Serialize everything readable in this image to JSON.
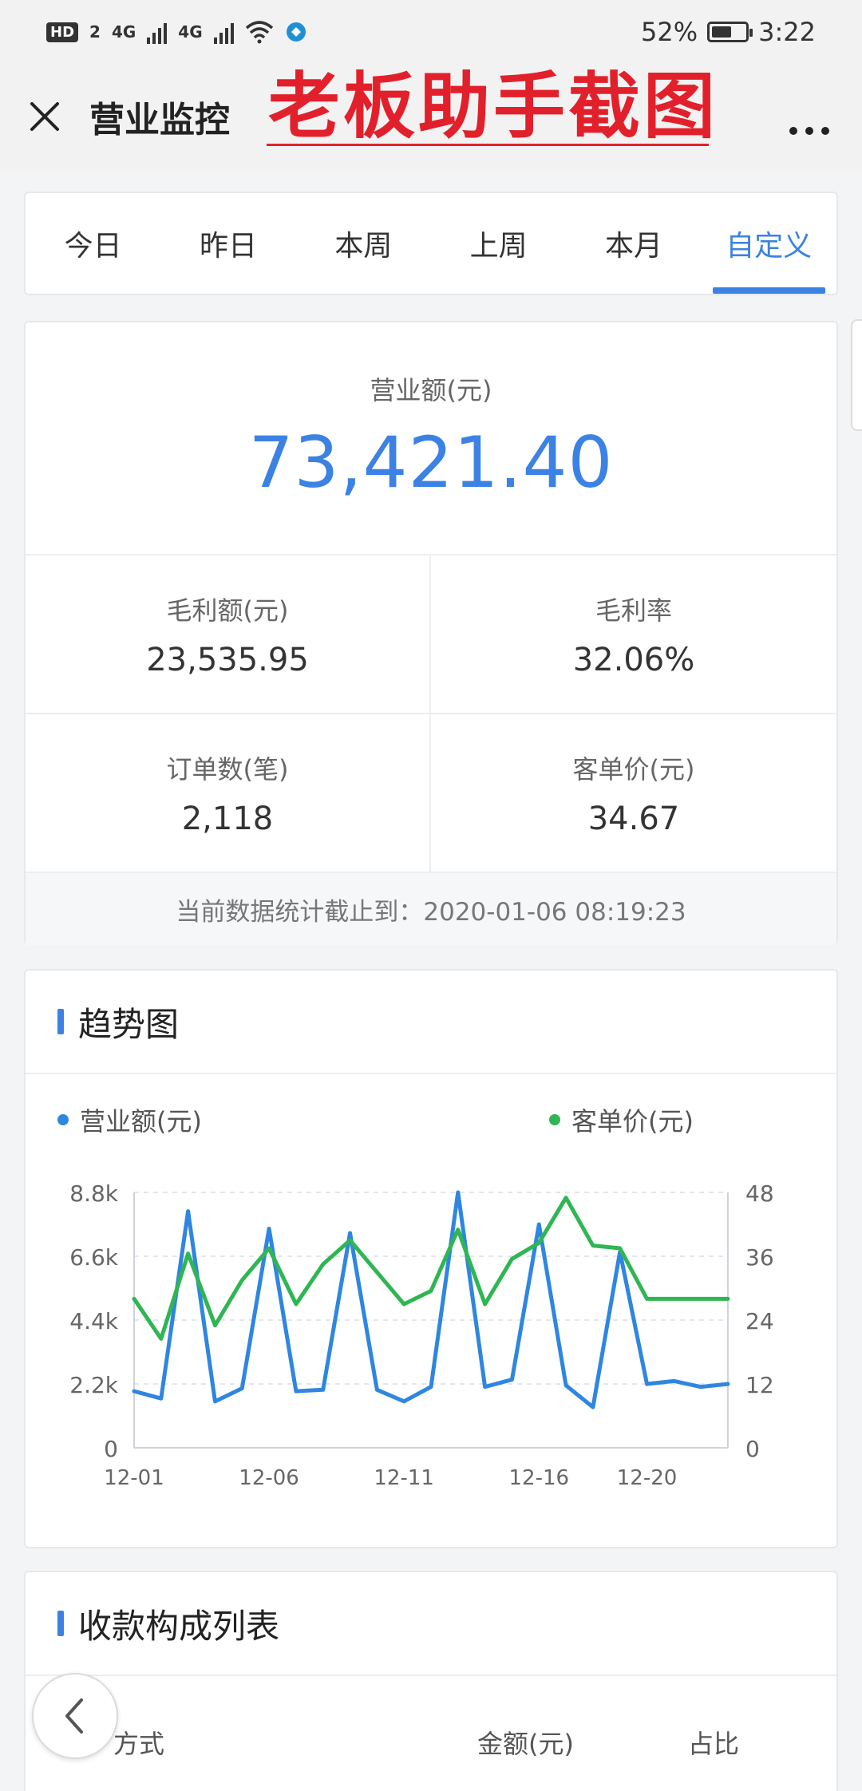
{
  "status_bar": {
    "hd": "HD",
    "hd_sub": "2",
    "net1": "4G",
    "net2": "4G",
    "battery": "52%",
    "battery_level": 0.52,
    "time": "3:22"
  },
  "titlebar": {
    "title": "营业监控",
    "watermark": "老板助手截图"
  },
  "tabs": [
    {
      "label": "今日",
      "active": false
    },
    {
      "label": "昨日",
      "active": false
    },
    {
      "label": "本周",
      "active": false
    },
    {
      "label": "上周",
      "active": false
    },
    {
      "label": "本月",
      "active": false
    },
    {
      "label": "自定义",
      "active": true
    }
  ],
  "summary": {
    "revenue_label": "营业额(元)",
    "revenue_value": "73,421.40",
    "metrics": [
      {
        "label": "毛利额(元)",
        "value": "23,535.95"
      },
      {
        "label": "毛利率",
        "value": "32.06%"
      },
      {
        "label": "订单数(笔)",
        "value": "2,118"
      },
      {
        "label": "客单价(元)",
        "value": "34.67"
      }
    ],
    "footnote": "当前数据统计截止到：2020-01-06 08:19:23"
  },
  "trend": {
    "title": "趋势图",
    "legend_revenue": "营业额(元)",
    "legend_avg": "客单价(元)"
  },
  "payments": {
    "title": "收款构成列表",
    "col_method": "方式",
    "col_amount": "金额(元)",
    "col_share": "占比"
  },
  "colors": {
    "accent": "#3b82e4",
    "revenue_line": "#2f86e0",
    "avg_line": "#2fb653",
    "watermark": "#e2202b"
  },
  "chart_data": {
    "type": "line",
    "x": [
      "12-01",
      "12-02",
      "12-03",
      "12-04",
      "12-05",
      "12-06",
      "12-07",
      "12-08",
      "12-09",
      "12-10",
      "12-11",
      "12-12",
      "12-13",
      "12-14",
      "12-15",
      "12-16",
      "12-17",
      "12-18",
      "12-19",
      "12-20",
      "12-21",
      "12-22",
      "12-23"
    ],
    "x_tick_labels": [
      "12-01",
      "12-06",
      "12-11",
      "12-16",
      "12-20"
    ],
    "series": [
      {
        "name": "营业额(元)",
        "axis": "left",
        "color": "#2f86e0",
        "values": [
          1950,
          1700,
          8150,
          1600,
          2050,
          7550,
          1950,
          2000,
          7400,
          2000,
          1600,
          2100,
          8800,
          2100,
          2350,
          7700,
          2150,
          1400,
          6750,
          2200,
          2300,
          2100,
          2200
        ]
      },
      {
        "name": "客单价(元)",
        "axis": "right",
        "color": "#2fb653",
        "values": [
          28,
          20.5,
          36.5,
          23,
          31.5,
          37.5,
          27,
          34.5,
          39,
          33,
          27,
          29.5,
          41,
          27,
          35.5,
          38.5,
          47,
          38,
          37.5,
          28,
          28,
          28,
          28
        ]
      }
    ],
    "y_left": {
      "ylim": [
        0,
        8800
      ],
      "ticks": [
        "0",
        "2.2k",
        "4.4k",
        "6.6k",
        "8.8k"
      ]
    },
    "y_right": {
      "ylim": [
        0,
        48
      ],
      "ticks": [
        "0",
        "12",
        "24",
        "36",
        "48"
      ]
    },
    "grid": true,
    "legend_placement": "top"
  }
}
